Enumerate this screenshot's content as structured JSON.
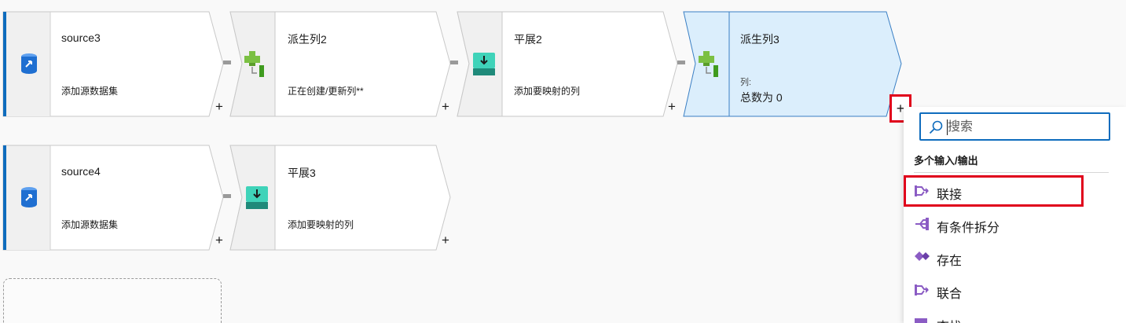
{
  "flow_row1": [
    {
      "title": "source3",
      "subtitle": "添加源数据集",
      "icon": "database-source-icon"
    },
    {
      "title": "派生列2",
      "subtitle": "正在创建/更新列**",
      "icon": "derived-column-icon"
    },
    {
      "title": "平展2",
      "subtitle": "添加要映射的列",
      "icon": "flatten-icon"
    },
    {
      "title": "派生列3",
      "subtitle": "列:",
      "count": "总数为 0",
      "icon": "derived-column-icon",
      "selected": true
    }
  ],
  "flow_row2": [
    {
      "title": "source4",
      "subtitle": "添加源数据集",
      "icon": "database-source-icon"
    },
    {
      "title": "平展3",
      "subtitle": "添加要映射的列",
      "icon": "flatten-icon"
    }
  ],
  "add_transform_label": "+",
  "menu": {
    "search_placeholder": "搜索",
    "section_label": "多个输入/输出",
    "items": [
      {
        "label": "联接",
        "icon": "join-icon"
      },
      {
        "label": "有条件拆分",
        "icon": "conditional-split-icon"
      },
      {
        "label": "存在",
        "icon": "exists-icon"
      },
      {
        "label": "联合",
        "icon": "union-icon"
      },
      {
        "label": "查找",
        "icon": "lookup-icon"
      }
    ]
  },
  "colors": {
    "accent": "#0f6cbd",
    "selected_fill": "#dbeefc",
    "highlight_border": "#e0001b"
  }
}
